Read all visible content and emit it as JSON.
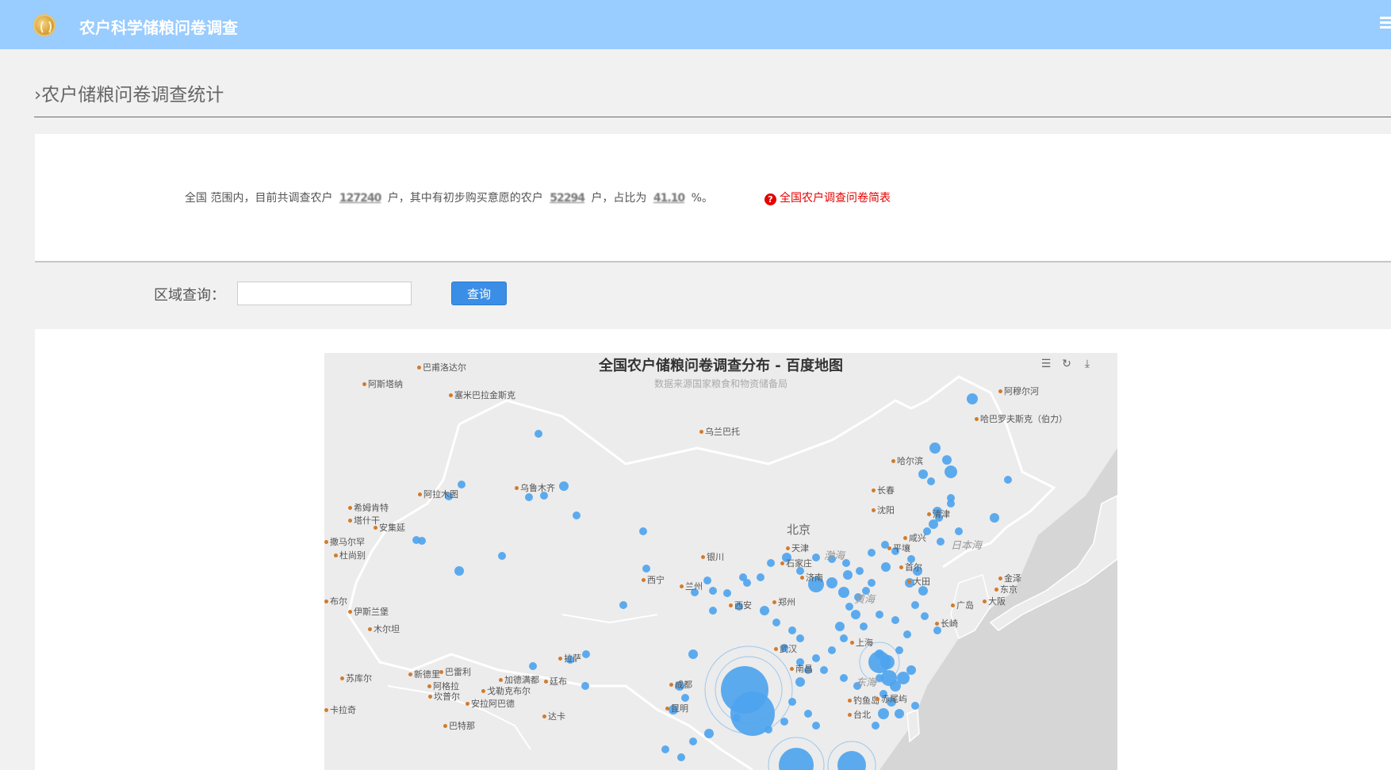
{
  "header": {
    "title": "农户科学储粮问卷调查",
    "logo_icon": "globe-logo-icon",
    "menu_icon": "hamburger-menu-icon"
  },
  "page": {
    "heading": "›农户储粮问卷调查统计"
  },
  "summary": {
    "prefix": "全国 范围内，目前共调查农户",
    "total_count": "127240",
    "mid1": "户，其中有初步购买意愿的农户",
    "willing_count": "52294",
    "mid2": "户，占比为",
    "percent": "41.10",
    "suffix": "%。",
    "link_label": "全国农户调查问卷简表",
    "link_color": "#e60000"
  },
  "query": {
    "label": "区域查询：",
    "input_value": "",
    "input_placeholder": "",
    "button_label": "查询",
    "button_color": "#3a8ee6"
  },
  "map": {
    "title": "全国农户储粮问卷调查分布 - 百度地图",
    "subtitle": "数据来源国家粮食和物资储备局",
    "tools": [
      "data-view-icon",
      "refresh-icon",
      "download-icon"
    ],
    "bubble_color": "#4da3ee",
    "cities": [
      "巴甫洛达尔",
      "阿斯塔纳",
      "塞米巴拉金斯克",
      "乌兰巴托",
      "阿穆尔河",
      "哈巴罗夫斯克（伯力）",
      "哈尔滨",
      "乌鲁木齐",
      "阿拉木图",
      "希姆肯特",
      "塔什干",
      "安集延",
      "撒马尔罕",
      "杜尚别",
      "北京",
      "天津",
      "银川",
      "石家庄",
      "兰州",
      "郑州",
      "西宁",
      "济南",
      "西安",
      "上海",
      "武汉",
      "南昌",
      "布尔",
      "伊斯兰堡",
      "木尔坦",
      "苏库尔",
      "新德里",
      "巴雷利",
      "阿格拉",
      "坎普尔",
      "加德满都",
      "拉萨",
      "廷布",
      "戈勒克布尔",
      "安拉阿巴德",
      "达卡",
      "沈阳",
      "清津",
      "首尔",
      "大田",
      "平壤",
      "咸兴",
      "金泽",
      "东京",
      "大阪",
      "广岛",
      "长崎",
      "钓鱼岛",
      "赤尾屿",
      "台北",
      "长春",
      "成都",
      "昆明",
      "卡拉奇",
      "巴特那"
    ],
    "big_labels": [
      "北京"
    ],
    "seas": [
      "渤海",
      "黄海",
      "东海",
      "日本海"
    ]
  }
}
